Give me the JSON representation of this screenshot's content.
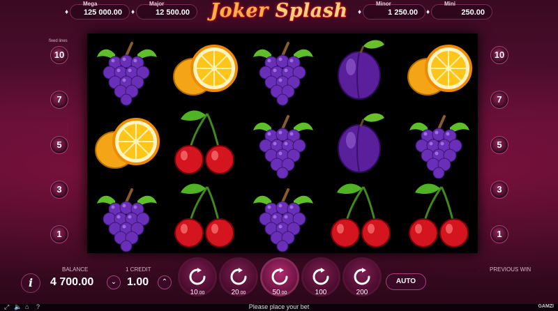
{
  "jackpots": {
    "mega": {
      "label": "Mega",
      "value": "125 000.00"
    },
    "major": {
      "label": "Major",
      "value": "12 500.00"
    },
    "minor": {
      "label": "Minor",
      "value": "1 250.00"
    },
    "mini": {
      "label": "Mini",
      "value": "250.00"
    }
  },
  "logo": {
    "word1": "Joker",
    "word2": "Splash"
  },
  "paylines": {
    "fixed_label": "fixed lines",
    "left": [
      "10",
      "7",
      "5",
      "3",
      "1"
    ],
    "right": [
      "10",
      "7",
      "5",
      "3",
      "1"
    ]
  },
  "reels": {
    "rows": [
      [
        "grapes",
        "orange",
        "grapes",
        "plum",
        "orange"
      ],
      [
        "orange",
        "cherries",
        "grapes",
        "plum",
        "grapes"
      ],
      [
        "grapes",
        "cherries",
        "grapes",
        "cherries",
        "cherries"
      ]
    ]
  },
  "controls": {
    "info_icon": "i",
    "balance_label": "BALANCE",
    "balance_value": "4 700.00",
    "credit_label": "1 CREDIT",
    "credit_value": "1.00",
    "credit_down": "⌄",
    "credit_up": "⌃",
    "bets": [
      {
        "whole": "10",
        "decimals": ".00"
      },
      {
        "whole": "20",
        "decimals": ".00"
      },
      {
        "whole": "50",
        "decimals": ".00"
      },
      {
        "whole": "100",
        "decimals": ""
      },
      {
        "whole": "200",
        "decimals": ""
      }
    ],
    "selected_bet": "50.00",
    "auto_label": "AUTO",
    "previous_win_label": "PREVIOUS WIN"
  },
  "status": {
    "message": "Please place your bet",
    "icons": [
      "fullscreen-icon",
      "sound-icon",
      "home-icon",
      "help-icon"
    ],
    "provider": "GAMZI"
  },
  "colors": {
    "accent": "#a8407a",
    "background": "#3a0a22",
    "logo": "#ffb347"
  }
}
